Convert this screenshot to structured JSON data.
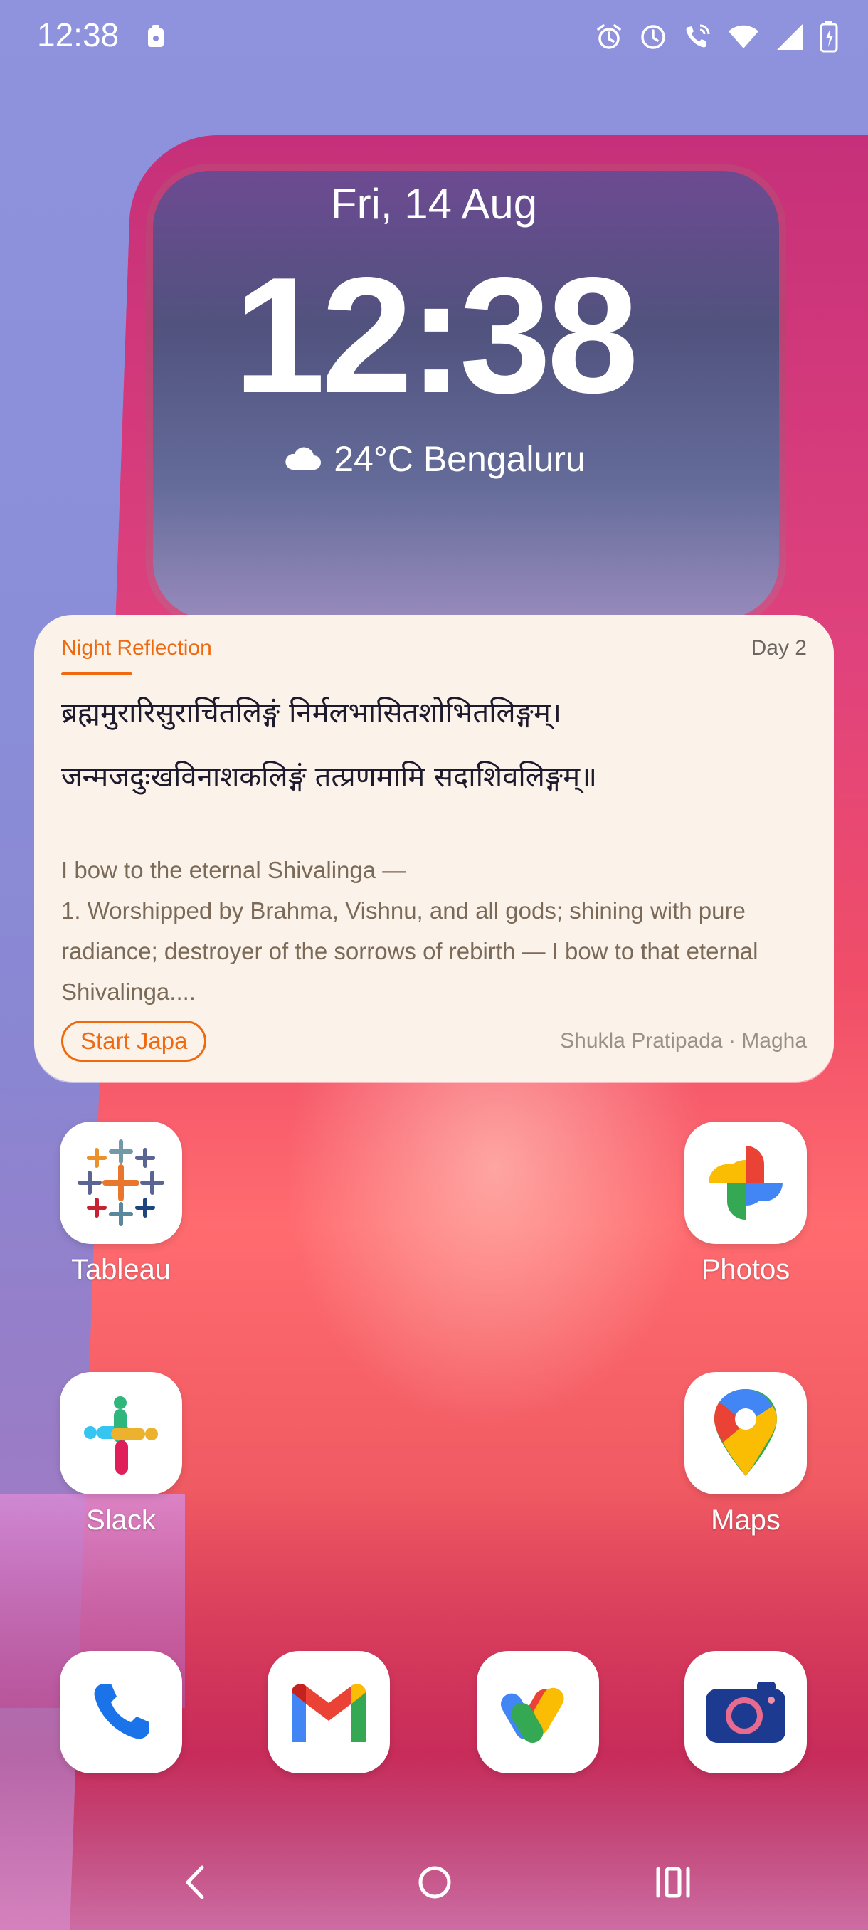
{
  "status_bar": {
    "time": "12:38",
    "icons": [
      "clipboard-icon",
      "alarm-icon",
      "clock-icon",
      "wifi-calling-icon",
      "wifi-icon",
      "signal-icon",
      "battery-charging-icon"
    ]
  },
  "lockscreen": {
    "date": "Fri, 14 Aug",
    "time": "12:38",
    "weather": "24°C Bengaluru"
  },
  "widget": {
    "label": "Night Reflection",
    "day": "Day 2",
    "verse_line_1": "ब्रह्ममुरारिसुरार्चितलिङ्गं निर्मलभासितशोभितलिङ्गम्।",
    "verse_line_2": "जन्मजदुःखविनाशकलिङ्गं तत्प्रणमामि सदाशिवलिङ्गम्॥",
    "translation": "I bow to the eternal Shivalinga —\n1. Worshipped by Brahma, Vishnu, and all gods; shining with pure radiance; destroyer of the sorrows of rebirth — I bow to that eternal Shivalinga....",
    "button": "Start Japa",
    "meta": "Shukla Pratipada · Magha",
    "accent": "#f0690f"
  },
  "apps": [
    {
      "label": "Tableau",
      "icon": "tableau-icon"
    },
    {
      "label": "Photos",
      "icon": "google-photos-icon"
    },
    {
      "label": "Slack",
      "icon": "slack-icon"
    },
    {
      "label": "Maps",
      "icon": "google-maps-icon"
    }
  ],
  "dock": [
    {
      "icon": "phone-icon"
    },
    {
      "icon": "gmail-icon"
    },
    {
      "icon": "google-pay-icon"
    },
    {
      "icon": "camera-icon"
    }
  ],
  "navbar": [
    "back-icon",
    "home-icon",
    "recents-icon"
  ]
}
